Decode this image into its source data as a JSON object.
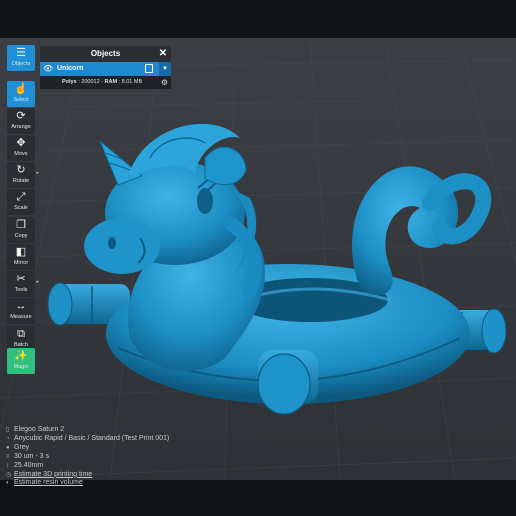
{
  "panel": {
    "title": "Objects",
    "close_icon": "close-icon",
    "object": {
      "name": "Unicorn",
      "visibility_icon": "eye-icon"
    },
    "stats": {
      "polys_label": "Polys",
      "polys_value": "200012",
      "ram_label": "RAM",
      "ram_value": "8.01 MB"
    }
  },
  "toolbar": {
    "objects": "Objects",
    "select": "Select",
    "arrange": "Arrange",
    "move": "Move",
    "rotate": "Rotate",
    "scale": "Scale",
    "copy": "Copy",
    "mirror": "Mirror",
    "tools": "Tools",
    "measure": "Measure",
    "batch": "Batch",
    "magic": "Magic"
  },
  "info": {
    "printer": "Elegoo Saturn 2",
    "resin": "Anycubic Rapid / Basic / Standard (Test Print 001)",
    "color": "Grey",
    "layer": "30 um - 3 s",
    "height": "25.40mm",
    "estimate_time": "Estimate 3D printing time",
    "estimate_resin": "Estimate resin volume"
  },
  "colors": {
    "accent": "#1f8fd6",
    "magic": "#2fbf7f",
    "model": "#1c8fc4",
    "background": "#3a3e43"
  }
}
